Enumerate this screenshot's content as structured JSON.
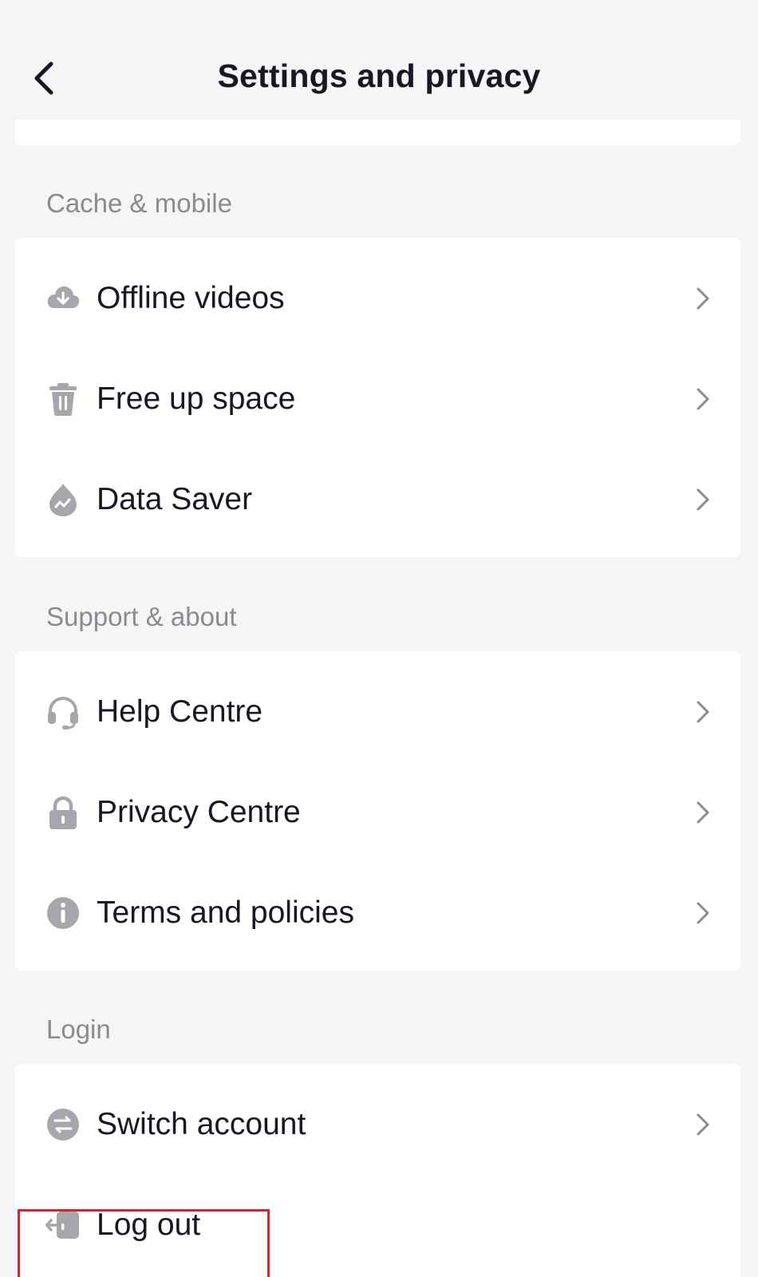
{
  "header": {
    "title": "Settings and privacy",
    "back_icon": "chevron-left-icon"
  },
  "sections": {
    "cache": {
      "label": "Cache & mobile",
      "items": [
        {
          "label": "Offline videos",
          "icon": "cloud-download-icon"
        },
        {
          "label": "Free up space",
          "icon": "trash-icon"
        },
        {
          "label": "Data Saver",
          "icon": "drop-icon"
        }
      ]
    },
    "support": {
      "label": "Support & about",
      "items": [
        {
          "label": "Help Centre",
          "icon": "headset-icon"
        },
        {
          "label": "Privacy Centre",
          "icon": "lock-icon"
        },
        {
          "label": "Terms and policies",
          "icon": "info-icon"
        }
      ]
    },
    "login": {
      "label": "Login",
      "items": [
        {
          "label": "Switch account",
          "icon": "switch-icon"
        },
        {
          "label": "Log out",
          "icon": "logout-icon"
        }
      ]
    }
  },
  "colors": {
    "background": "#f5f5f5",
    "card": "#ffffff",
    "text": "#161823",
    "muted": "#8a8b91",
    "icon": "#a6a7ab",
    "highlight": "#e0212b"
  }
}
